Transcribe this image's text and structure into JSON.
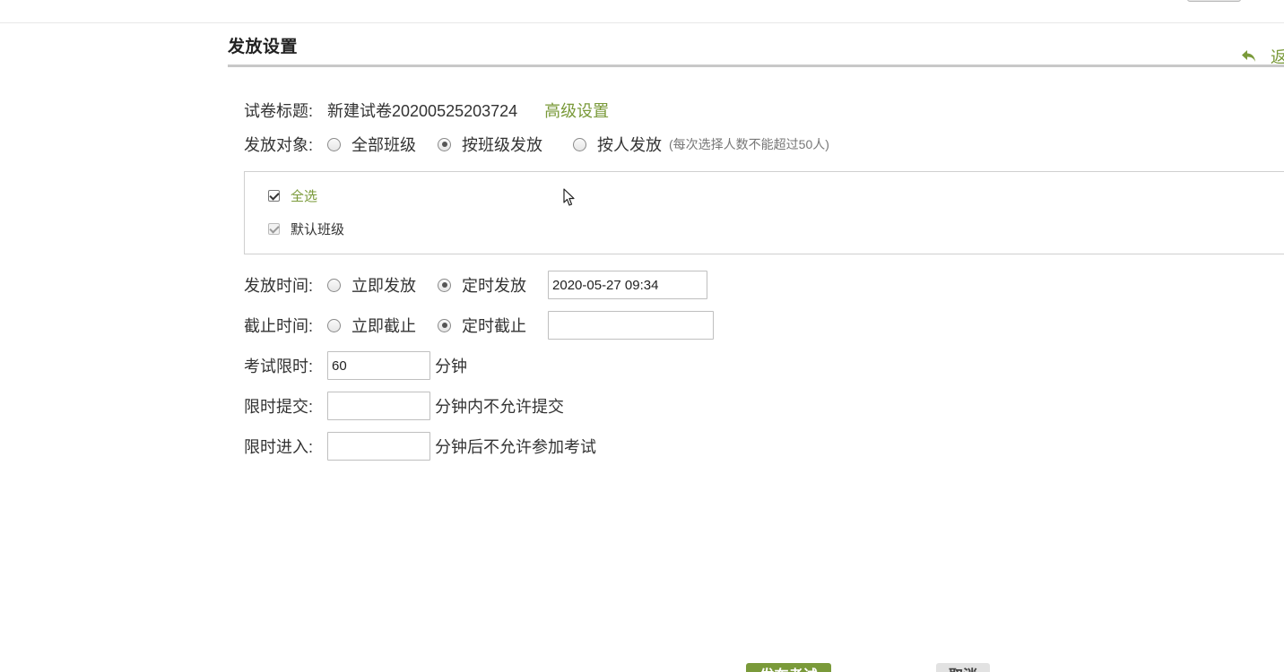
{
  "header": {
    "title": "发放设置",
    "back_label": "返"
  },
  "form": {
    "paper_title": {
      "label": "试卷标题:",
      "value": "新建试卷20200525203724",
      "advanced_link": "高级设置"
    },
    "target": {
      "label": "发放对象:",
      "options": [
        "全部班级",
        "按班级发放",
        "按人发放"
      ],
      "selected": "按班级发放",
      "hint": "(每次选择人数不能超过50人)"
    },
    "classes": {
      "select_all_label": "全选",
      "items": [
        {
          "label": "默认班级",
          "checked": true
        }
      ]
    },
    "publish_time": {
      "label": "发放时间:",
      "options": [
        "立即发放",
        "定时发放"
      ],
      "selected": "定时发放",
      "value": "2020-05-27 09:34"
    },
    "deadline": {
      "label": "截止时间:",
      "options": [
        "立即截止",
        "定时截止"
      ],
      "selected": "定时截止",
      "value": ""
    },
    "time_limit": {
      "label": "考试限时:",
      "value": "60",
      "unit": "分钟"
    },
    "submit_limit": {
      "label": "限时提交:",
      "value": "",
      "suffix": "分钟内不允许提交"
    },
    "entry_limit": {
      "label": "限时进入:",
      "value": "",
      "suffix": "分钟后不允许参加考试"
    }
  },
  "footer": {
    "publish_label": "发布考试",
    "cancel_label": "取消"
  },
  "colors": {
    "accent": "#7a9a3a",
    "rule": "#c8c8c8",
    "border": "#cfcfcf"
  }
}
